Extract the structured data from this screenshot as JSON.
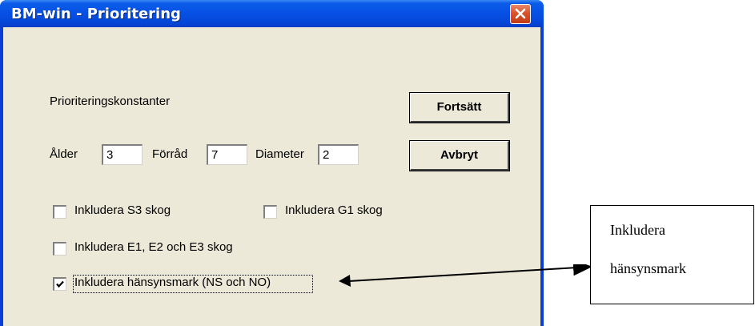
{
  "window": {
    "title": "BM-win - Prioritering"
  },
  "dialog": {
    "section_label": "Prioriteringskonstanter",
    "fields": [
      {
        "label": "Ålder",
        "value": "3"
      },
      {
        "label": "Förråd",
        "value": "7"
      },
      {
        "label": "Diameter",
        "value": "2"
      }
    ],
    "buttons": {
      "continue_label": "Fortsätt",
      "cancel_label": "Avbryt"
    },
    "checkboxes": [
      {
        "label": "Inkludera S3 skog",
        "checked": false
      },
      {
        "label": "Inkludera G1 skog",
        "checked": false
      },
      {
        "label": "Inkludera E1, E2 och E3 skog",
        "checked": false
      },
      {
        "label": "Inkludera hänsynsmark (NS och NO)",
        "checked": true
      }
    ]
  },
  "annotation": {
    "line1": "Inkludera",
    "line2": "hänsynsmark"
  },
  "colors": {
    "titlebar": "#0650e4",
    "dialog_face": "#ece9d8",
    "close_button": "#d9532c"
  },
  "icons": {
    "close": "close-icon",
    "check": "checkmark-icon"
  }
}
